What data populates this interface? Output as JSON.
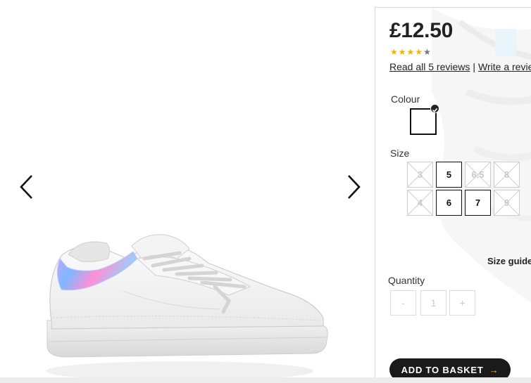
{
  "gallery": {
    "prev_icon": "chevron-left-icon",
    "next_icon": "chevron-right-icon",
    "image": "white-trainer-iridescent-heel-tab"
  },
  "product": {
    "price": "£12.50",
    "rating": 4,
    "rating_max": 5,
    "star_color": "#f5b400",
    "read_reviews": "Read all 5 reviews",
    "separator": "|",
    "write_review": "Write a revie"
  },
  "colour": {
    "label": "Colour",
    "selected": "white"
  },
  "size": {
    "label": "Size",
    "options": [
      {
        "value": "3",
        "available": false
      },
      {
        "value": "5",
        "available": true
      },
      {
        "value": "6.5",
        "available": false
      },
      {
        "value": "8",
        "available": false
      },
      {
        "value": "4",
        "available": false
      },
      {
        "value": "6",
        "available": true
      },
      {
        "value": "7",
        "available": true
      },
      {
        "value": "9",
        "available": false
      }
    ],
    "guide": "Size guide"
  },
  "quantity": {
    "label": "Quantity",
    "minus": "-",
    "value": "1",
    "plus": "+"
  },
  "basket": {
    "label": "ADD TO BASKET",
    "arrow": "→",
    "arrow_color": "#f5c200"
  }
}
